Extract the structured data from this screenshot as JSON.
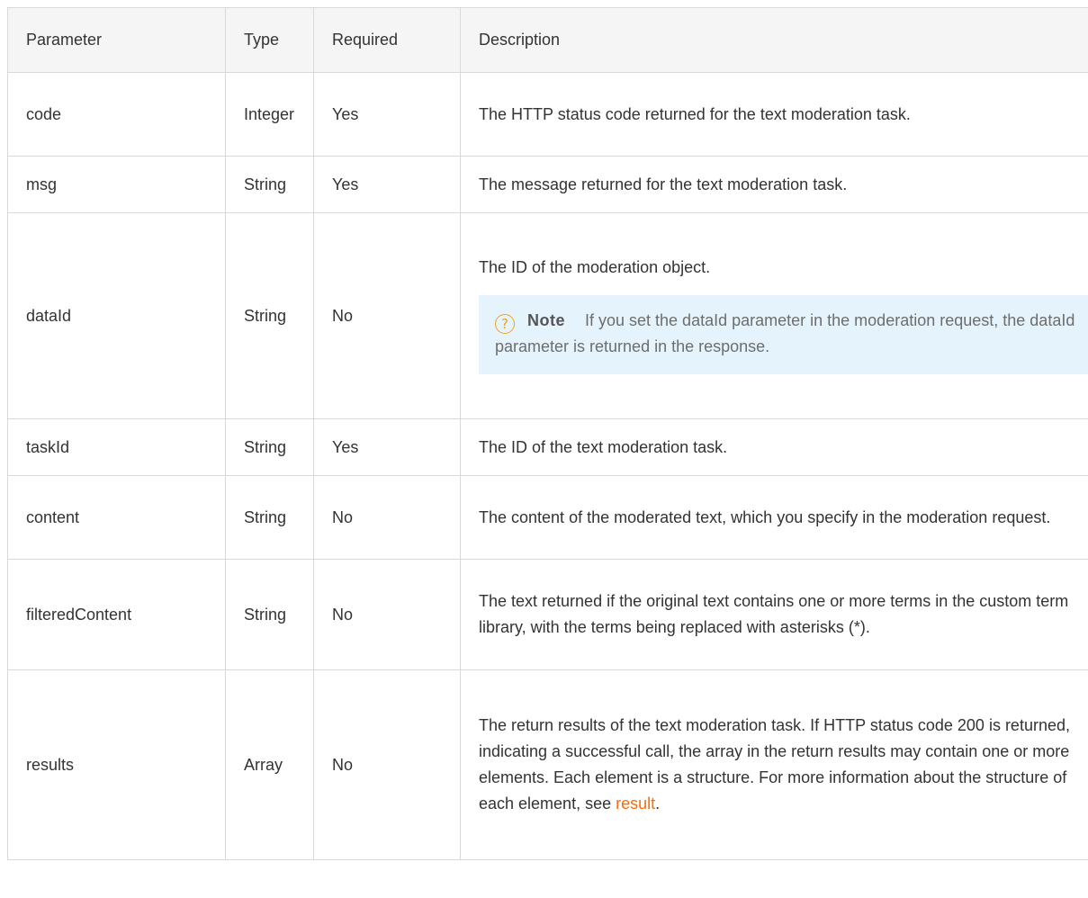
{
  "headers": {
    "parameter": "Parameter",
    "type": "Type",
    "required": "Required",
    "description": "Description"
  },
  "rows": {
    "code": {
      "parameter": "code",
      "type": "Integer",
      "required": "Yes",
      "description": "The HTTP status code returned for the text moderation task."
    },
    "msg": {
      "parameter": "msg",
      "type": "String",
      "required": "Yes",
      "description": "The message returned for the text moderation task."
    },
    "dataId": {
      "parameter": "dataId",
      "type": "String",
      "required": "No",
      "description": "The ID of the moderation object.",
      "note_icon": "question-circle-icon",
      "note_icon_glyph": "?",
      "note_title": "Note",
      "note_text": "If you set the dataId parameter in the moderation request, the dataId parameter is returned in the response."
    },
    "taskId": {
      "parameter": "taskId",
      "type": "String",
      "required": "Yes",
      "description": "The ID of the text moderation task."
    },
    "content": {
      "parameter": "content",
      "type": "String",
      "required": "No",
      "description": "The content of the moderated text, which you specify in the moderation request."
    },
    "filteredContent": {
      "parameter": "filteredContent",
      "type": "String",
      "required": "No",
      "description": "The text returned if the original text contains one or more terms in the custom term library, with the terms being replaced with asterisks (*)."
    },
    "results": {
      "parameter": "results",
      "type": "Array",
      "required": "No",
      "description": "The return results of the text moderation task. If HTTP status code 200 is returned, indicating a successful call, the array in the return results may contain one or more elements. Each element is a structure. For more information about the structure of each element, see",
      "link_text": "result",
      "trailing": "."
    }
  },
  "colors": {
    "border": "#d9d9d9",
    "header_bg": "#f5f5f5",
    "note_bg": "#e5f4fc",
    "note_icon": "#f0a020",
    "link": "#ff6a00"
  }
}
